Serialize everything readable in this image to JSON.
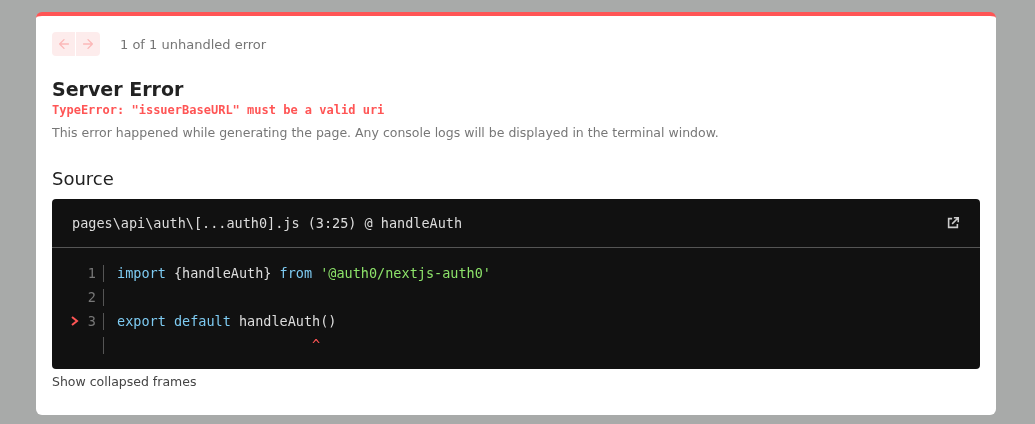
{
  "nav": {
    "buttons": [
      {
        "kind": "previous",
        "disabled": true
      },
      {
        "kind": "next",
        "disabled": true
      }
    ],
    "counter": "1 of 1 unhandled error"
  },
  "error": {
    "title": "Server Error",
    "message": "TypeError: \"issuerBaseURL\" must be a valid uri",
    "description": "This error happened while generating the page. Any console logs will be displayed in the terminal window."
  },
  "source": {
    "heading": "Source",
    "file": "pages\\api\\auth\\[...auth0].js (3:25) @ handleAuth",
    "lines": [
      {
        "number": "1",
        "highlighted": false,
        "tokens": [
          {
            "kind": "keyword",
            "text": "import"
          },
          {
            "kind": "plain",
            "text": " {handleAuth} "
          },
          {
            "kind": "keyword",
            "text": "from"
          },
          {
            "kind": "string",
            "text": " '@auth0/nextjs-auth0'"
          }
        ]
      },
      {
        "number": "2",
        "highlighted": false
      },
      {
        "number": "3",
        "highlighted": true,
        "tokens": [
          {
            "kind": "keyword",
            "text": "export"
          },
          {
            "kind": "keyword",
            "text": " default"
          },
          {
            "kind": "plain",
            "text": " handleAuth()"
          }
        ]
      },
      {
        "highlighted": false,
        "tokens": [
          {
            "kind": "caret",
            "text": "                        ^"
          }
        ]
      }
    ],
    "link": "Show collapsed frames"
  }
}
